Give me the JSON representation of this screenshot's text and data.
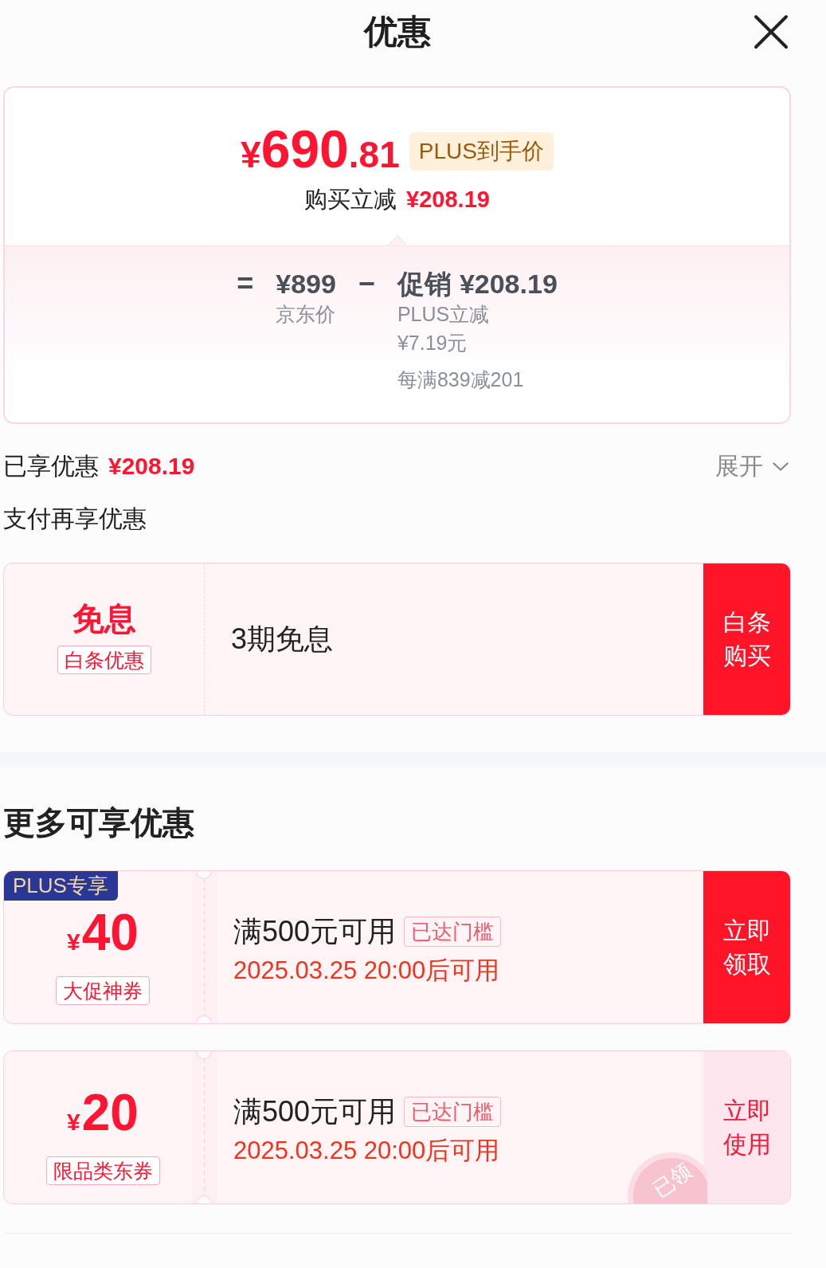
{
  "header": {
    "title": "优惠"
  },
  "price_card": {
    "final_price": {
      "currency": "¥",
      "integer": "690",
      "decimal": ".81"
    },
    "badge": "PLUS到手价",
    "saving_label": "购买立减",
    "saving_amount": "¥208.19",
    "breakdown": {
      "equals": "=",
      "base": {
        "amount": "¥899",
        "label": "京东价"
      },
      "minus": "−",
      "promo": {
        "label": "促销",
        "amount": "¥208.19",
        "details": [
          {
            "lines": [
              "PLUS立减",
              "¥7.19元"
            ]
          },
          {
            "lines": [
              "每满839减201"
            ]
          }
        ]
      }
    }
  },
  "enjoyed": {
    "label": "已享优惠",
    "amount": "¥208.19",
    "toggle": "展开",
    "expanded": false
  },
  "pay_section": {
    "title": "支付再享优惠",
    "offers": [
      {
        "headline": "免息",
        "tag": "白条优惠",
        "description": "3期免息",
        "button": "白条购买"
      }
    ]
  },
  "more_section": {
    "title": "更多可享优惠",
    "coupons": [
      {
        "corner_tag": "PLUS专享",
        "currency": "¥",
        "value": "40",
        "tag": "大促神券",
        "condition": "满500元可用",
        "badge": "已达门槛",
        "valid_from": "2025.03.25 20:00后可用",
        "button": "立即领取",
        "claimed": false
      },
      {
        "currency": "¥",
        "value": "20",
        "tag": "限品类东券",
        "condition": "满500元可用",
        "badge": "已达门槛",
        "valid_from": "2025.03.25 20:00后可用",
        "button": "立即使用",
        "claimed": true,
        "stamp": "已领"
      }
    ]
  }
}
